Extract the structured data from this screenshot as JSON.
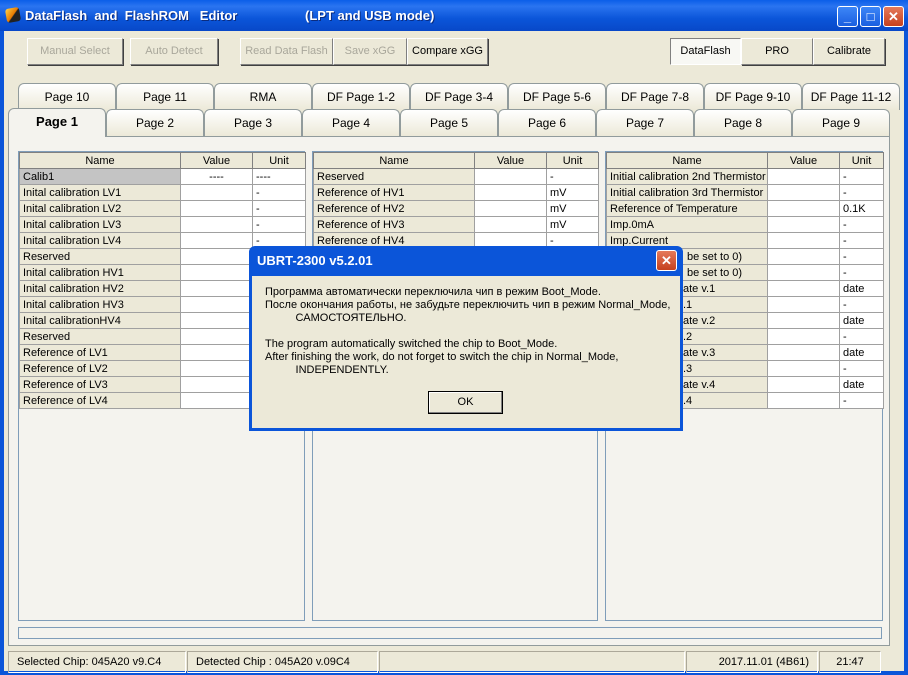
{
  "window": {
    "title": "DataFlash  and  FlashROM   Editor",
    "subtitle": "(LPT and USB mode)",
    "minimize": "_",
    "maximize": "□",
    "close": "✕"
  },
  "toolbar": {
    "manual_select": "Manual Select",
    "auto_detect": "Auto Detect",
    "read_data_flash": "Read Data Flash",
    "save_xgg": "Save xGG",
    "compare_xgg": "Compare xGG",
    "dataflash": "DataFlash",
    "pro": "PRO",
    "calibrate": "Calibrate"
  },
  "tabs_row1": [
    "Page 10",
    "Page 11",
    "RMA",
    "DF Page 1-2",
    "DF Page 3-4",
    "DF Page 5-6",
    "DF Page 7-8",
    "DF Page 9-10",
    "DF Page 11-12"
  ],
  "tabs_row2": [
    "Page 1",
    "Page 2",
    "Page 3",
    "Page 4",
    "Page 5",
    "Page 6",
    "Page 7",
    "Page 8",
    "Page 9"
  ],
  "selected_tab": "Page 1",
  "columns": {
    "name": "Name",
    "value": "Value",
    "unit": "Unit"
  },
  "tables": [
    {
      "rows": [
        [
          "Calib1",
          "----",
          "----"
        ],
        [
          "Inital calibration LV1",
          "",
          "-"
        ],
        [
          "Inital calibration LV2",
          "",
          "-"
        ],
        [
          "Inital calibration LV3",
          "",
          "-"
        ],
        [
          "Inital calibration LV4",
          "",
          "-"
        ],
        [
          "Reserved",
          "",
          ""
        ],
        [
          "Inital calibration HV1",
          "",
          ""
        ],
        [
          "Inital calibration HV2",
          "",
          ""
        ],
        [
          "Inital calibration HV3",
          "",
          ""
        ],
        [
          "Inital calibrationHV4",
          "",
          ""
        ],
        [
          "Reserved",
          "",
          ""
        ],
        [
          "Reference of LV1",
          "",
          ""
        ],
        [
          "Reference of LV2",
          "",
          ""
        ],
        [
          "Reference of LV3",
          "",
          ""
        ],
        [
          "Reference of LV4",
          "",
          ""
        ]
      ]
    },
    {
      "rows": [
        [
          "Reserved",
          "",
          "-"
        ],
        [
          "Reference of HV1",
          "",
          "mV"
        ],
        [
          "Reference of HV2",
          "",
          "mV"
        ],
        [
          "Reference of HV3",
          "",
          "mV"
        ],
        [
          "Reference of HV4",
          "",
          "-"
        ]
      ]
    },
    {
      "rows": [
        [
          "Initial calibration 2nd Thermistor",
          "",
          "-"
        ],
        [
          "Initial calibration 3rd Thermistor",
          "",
          "-"
        ],
        [
          "Reference of Temperature",
          "",
          "0.1K"
        ],
        [
          "Imp.0mA",
          "",
          "-"
        ],
        [
          "Imp.Current",
          "",
          "-"
        ],
        [
          "be set to 0)",
          "",
          "-"
        ],
        [
          "be set to 0)",
          "",
          "-"
        ],
        [
          "ate v.1",
          "",
          "date"
        ],
        [
          ".1",
          "",
          "-"
        ],
        [
          "ate v.2",
          "",
          "date"
        ],
        [
          ".2",
          "",
          "-"
        ],
        [
          "ate v.3",
          "",
          "date"
        ],
        [
          ".3",
          "",
          "-"
        ],
        [
          "ate v.4",
          "",
          "date"
        ],
        [
          ".4",
          "",
          "-"
        ]
      ]
    }
  ],
  "status": {
    "selected_chip": "Selected Chip:  045A20 v9.C4",
    "detected_chip": "Detected Chip : 045A20  v.09C4",
    "empty": "",
    "date": "2017.11.01  (4B61)",
    "time": "21:47"
  },
  "dialog": {
    "title": "UBRT-2300 v5.2.01",
    "lines": [
      "Программа автоматически переключила чип в режим Boot_Mode.",
      "После окончания работы, не забудьте переключить чип в режим Normal_Mode,",
      "          САМОСТОЯТЕЛЬНО.",
      "The program automatically switched the chip to Boot_Mode.",
      "After finishing the work, do not forget to switch the chip in Normal_Mode,",
      "          INDEPENDENTLY."
    ],
    "ok": "OK"
  }
}
